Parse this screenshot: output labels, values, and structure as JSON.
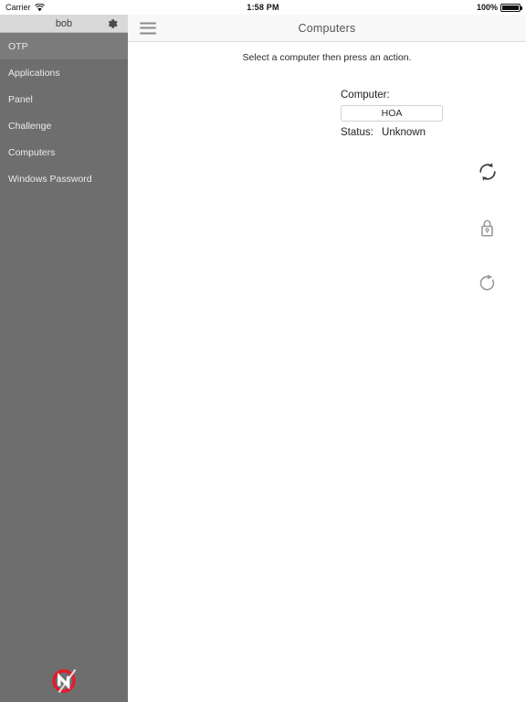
{
  "status_bar": {
    "carrier": "Carrier",
    "wifi_icon": "wifi-icon",
    "time": "1:58 PM",
    "battery_percent": "100%",
    "battery_icon": "battery-full-icon"
  },
  "sidebar": {
    "user": "bob",
    "settings_icon": "gear-icon",
    "brand_logo_icon": "netwrix-bolt-logo",
    "background_color": "#6e6e6e",
    "header_color": "#d9d9d9",
    "selected_item": "OTP",
    "items": [
      {
        "label": "OTP",
        "name": "sidebar-item-otp",
        "selected": true
      },
      {
        "label": "Applications",
        "name": "sidebar-item-applications",
        "selected": false
      },
      {
        "label": "Panel",
        "name": "sidebar-item-panel",
        "selected": false
      },
      {
        "label": "Challenge",
        "name": "sidebar-item-challenge",
        "selected": false
      },
      {
        "label": "Computers",
        "name": "sidebar-item-computers",
        "selected": false
      },
      {
        "label": "Windows Password",
        "name": "sidebar-item-windows-password",
        "selected": false
      }
    ]
  },
  "navbar": {
    "menu_icon": "hamburger-menu-icon",
    "title": "Computers"
  },
  "main": {
    "instruction": "Select a computer then press an action.",
    "computer_label": "Computer:",
    "computer_value": "HOA",
    "status_label": "Status:",
    "status_value": "Unknown",
    "actions": [
      {
        "name": "sync-button",
        "icon": "sync-icon",
        "color": "#3c3c3c"
      },
      {
        "name": "unlock-button",
        "icon": "unlock-icon",
        "color": "#9a9a9a"
      },
      {
        "name": "lock-button",
        "icon": "lock-icon",
        "color": "#9a9a9a"
      },
      {
        "name": "logoff-button",
        "icon": "logout-icon",
        "color": "#9a9a9a"
      },
      {
        "name": "restart-button",
        "icon": "restart-icon",
        "color": "#9a9a9a"
      },
      {
        "name": "shutdown-button",
        "icon": "power-icon",
        "color": "#9a9a9a"
      }
    ]
  }
}
